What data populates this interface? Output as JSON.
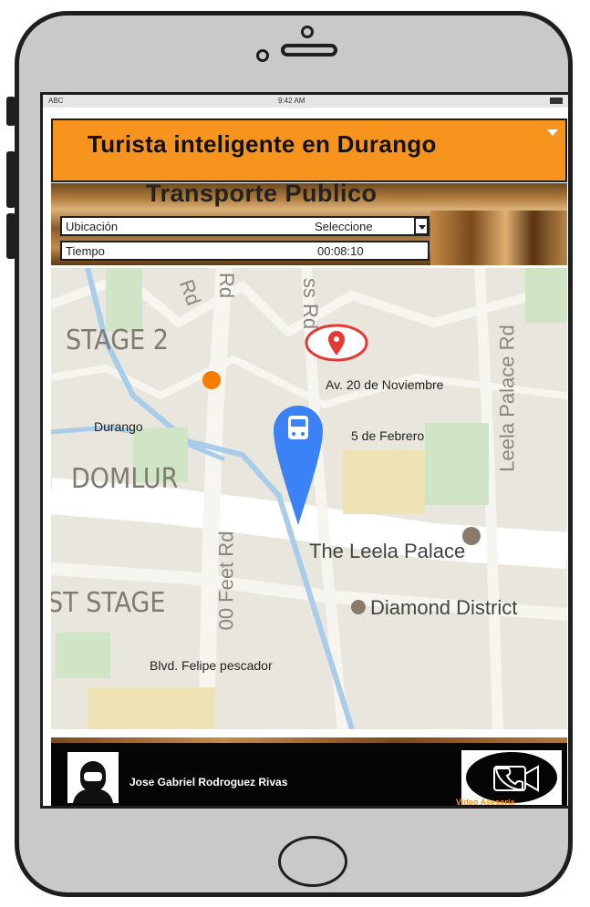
{
  "status_bar": {
    "carrier": "ABC",
    "time": "9:42 AM"
  },
  "header": {
    "title": "Turista inteligente en Durango"
  },
  "banner": {
    "title": "Transporte  Publico"
  },
  "form": {
    "location": {
      "label": "Ubicación",
      "value": "Seleccione"
    },
    "time": {
      "label": "Tiempo",
      "value": "00:08:10"
    }
  },
  "map": {
    "area_labels": [
      "STAGE 2",
      "DOMLUR",
      "ST STAGE"
    ],
    "road_labels": [
      "Rd",
      "Rd",
      "ss Rd",
      "00 Feet Rd",
      "Leela Palace Rd"
    ],
    "poi_labels": [
      "The Leela Palace",
      "Diamond District"
    ],
    "pins": {
      "destination": "Av. 20 de Noviembre",
      "via": "5 de Febrero",
      "origin": "Durango",
      "street": "Blvd. Felipe pescador"
    }
  },
  "footer": {
    "agent_name": "Jose Gabriel Rodroguez Rivas",
    "video_label": "Video Asesoria"
  },
  "colors": {
    "accent": "#f7941d",
    "pin_blue": "#3b82f6",
    "pin_red": "#e53935"
  }
}
